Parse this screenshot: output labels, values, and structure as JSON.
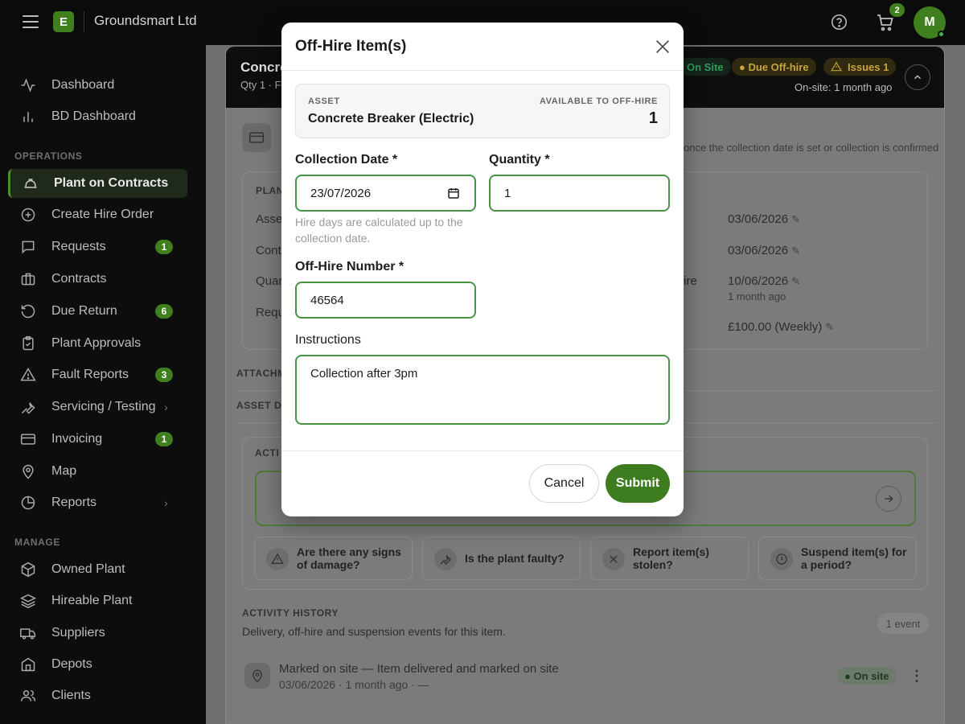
{
  "app": {
    "logo_letter": "E",
    "company": "Groundsmart Ltd",
    "cart_count": "2",
    "avatar_initial": "M",
    "accent_color": "#3f7f1e"
  },
  "sidebar": {
    "items_top": [
      {
        "label": "Dashboard",
        "icon": "activity-icon"
      },
      {
        "label": "BD Dashboard",
        "icon": "bar-chart-icon"
      }
    ],
    "operations_label": "OPERATIONS",
    "operations": [
      {
        "label": "Plant on Contracts",
        "icon": "hard-hat-icon",
        "active": true
      },
      {
        "label": "Create Hire Order",
        "icon": "plus-circle-icon"
      },
      {
        "label": "Requests",
        "icon": "message-icon",
        "badge": "1"
      },
      {
        "label": "Contracts",
        "icon": "briefcase-icon"
      },
      {
        "label": "Due Return",
        "icon": "rotate-ccw-icon",
        "badge": "6"
      },
      {
        "label": "Plant Approvals",
        "icon": "clipboard-check-icon"
      },
      {
        "label": "Fault Reports",
        "icon": "alert-triangle-icon",
        "badge": "3"
      },
      {
        "label": "Servicing / Testing",
        "icon": "wrench-icon",
        "chevron": "›"
      },
      {
        "label": "Invoicing",
        "icon": "credit-card-icon",
        "badge": "1"
      },
      {
        "label": "Map",
        "icon": "map-pin-icon"
      },
      {
        "label": "Reports",
        "icon": "pie-chart-icon",
        "chevron": "›"
      }
    ],
    "manage_label": "MANAGE",
    "manage": [
      {
        "label": "Owned Plant",
        "icon": "box-icon"
      },
      {
        "label": "Hireable Plant",
        "icon": "layers-icon"
      },
      {
        "label": "Suppliers",
        "icon": "truck-icon"
      },
      {
        "label": "Depots",
        "icon": "building-icon"
      },
      {
        "label": "Clients",
        "icon": "users-icon"
      }
    ]
  },
  "background": {
    "title": "Concre",
    "subtitle": "Qty 1 · F",
    "status_onsite": "On Site",
    "status_due": "● Due Off-hire",
    "status_issues": "Issues 1",
    "onsite_since": "On-site: 1 month ago",
    "notice": "once the collection date is set or collection is confirmed",
    "plant_cap": "PLAN",
    "row_labels": [
      "Asse",
      "Cont",
      "Quar",
      "Requ"
    ],
    "hire_label": "ire",
    "dates": [
      "03/06/2026",
      "03/06/2026",
      "10/06/2026"
    ],
    "ago": "1 month ago",
    "rate": "£100.00 (Weekly)",
    "attach_cap": "ATTACHM",
    "asset_doc_cap": "ASSET DO",
    "actions_cap": "ACTI",
    "action_tiles": [
      {
        "text": "Are there any signs of damage?",
        "icon": "alert-triangle-icon"
      },
      {
        "text": "Is the plant faulty?",
        "icon": "wrench-icon"
      },
      {
        "text": "Report item(s) stolen?",
        "icon": "x-icon"
      },
      {
        "text": "Suspend item(s) for a period?",
        "icon": "clock-icon"
      }
    ],
    "activity_cap": "ACTIVITY HISTORY",
    "activity_desc": "Delivery, off-hire and suspension events for this item.",
    "event_count": "1 event",
    "event_title": "Marked on site — Item delivered and marked on site",
    "event_meta": "03/06/2026 · 1 month ago · —",
    "event_status": "● On site"
  },
  "modal": {
    "title": "Off-Hire Item(s)",
    "asset_caption": "ASSET",
    "asset_name": "Concrete Breaker (Electric)",
    "available_caption": "AVAILABLE TO OFF-HIRE",
    "available_count": "1",
    "collection_label": "Collection Date *",
    "collection_value": "23/07/2026",
    "collection_help": "Hire days are calculated up to the collection date.",
    "quantity_label": "Quantity *",
    "quantity_value": "1",
    "offhire_label": "Off-Hire Number *",
    "offhire_value": "46564",
    "instructions_label": "Instructions",
    "instructions_value": "Collection after 3pm",
    "cancel_label": "Cancel",
    "submit_label": "Submit"
  }
}
